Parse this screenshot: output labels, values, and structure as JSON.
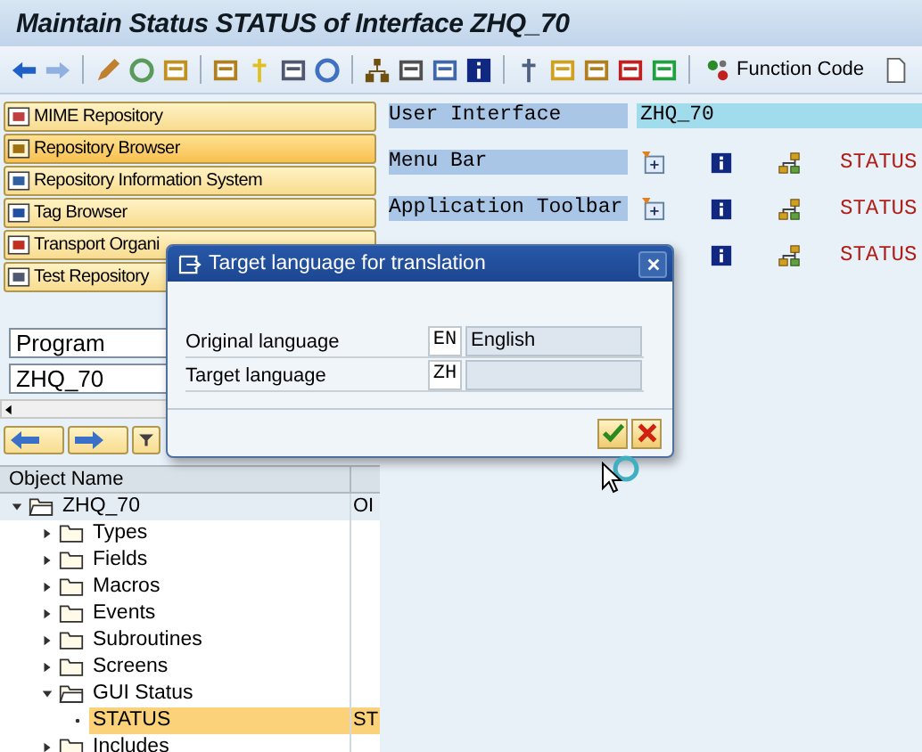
{
  "window": {
    "title": "Maintain Status STATUS of Interface ZHQ_70"
  },
  "toolbar": {
    "function_button": "Function Code"
  },
  "nav_buttons": [
    {
      "label": "MIME Repository",
      "selected": false
    },
    {
      "label": "Repository Browser",
      "selected": true
    },
    {
      "label": "Repository Information System",
      "selected": false
    },
    {
      "label": "Tag Browser",
      "selected": false
    },
    {
      "label": "Transport Organi",
      "selected": false
    },
    {
      "label": "Test Repository",
      "selected": false
    }
  ],
  "object_type": {
    "value": "Program"
  },
  "object_name": {
    "value": "ZHQ_70"
  },
  "tree": {
    "columns": [
      "Object Name"
    ],
    "nodes": [
      {
        "label": "ZHQ_70",
        "col2": "OI",
        "expanded": true,
        "selected": false,
        "children": [
          {
            "label": "Types",
            "expanded": false,
            "selected": false
          },
          {
            "label": "Fields",
            "expanded": false,
            "selected": false
          },
          {
            "label": "Macros",
            "expanded": false,
            "selected": false
          },
          {
            "label": "Events",
            "expanded": false,
            "selected": false
          },
          {
            "label": "Subroutines",
            "expanded": false,
            "selected": false
          },
          {
            "label": "Screens",
            "expanded": false,
            "selected": false
          },
          {
            "label": "GUI Status",
            "expanded": true,
            "selected": false,
            "children": [
              {
                "label": "STATUS",
                "col2": "ST",
                "selected": true,
                "kind": "leaf"
              }
            ]
          },
          {
            "label": "Includes",
            "expanded": false,
            "selected": false
          }
        ]
      }
    ]
  },
  "interface": {
    "label": "User Interface",
    "value": "ZHQ_70"
  },
  "elements": [
    {
      "label": "Menu Bar",
      "status": "STATUS"
    },
    {
      "label": "Application Toolbar",
      "status": "STATUS"
    },
    {
      "status": "STATUS"
    }
  ],
  "dialog": {
    "title": "Target language for translation",
    "rows": [
      {
        "label": "Original language",
        "code": "EN",
        "name": "English"
      },
      {
        "label": "Target language",
        "code": "ZH"
      }
    ]
  }
}
